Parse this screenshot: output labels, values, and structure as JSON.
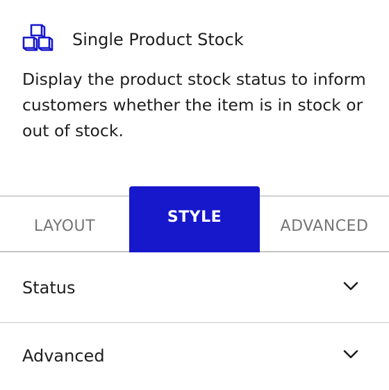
{
  "block": {
    "icon": "boxes-icon",
    "title": "Single Product Stock",
    "description": "Display the product stock status to inform customers whether the item is in stock or out of stock."
  },
  "tabs": [
    {
      "label": "LAYOUT",
      "active": false
    },
    {
      "label": "STYLE",
      "active": true
    },
    {
      "label": "ADVANCED",
      "active": false
    }
  ],
  "panels": [
    {
      "label": "Status",
      "icon": "chevron-down-icon"
    },
    {
      "label": "Advanced",
      "icon": "chevron-down-icon"
    }
  ],
  "colors": {
    "accent": "#1717cc",
    "text": "#1e1e1e",
    "muted": "#757575"
  }
}
